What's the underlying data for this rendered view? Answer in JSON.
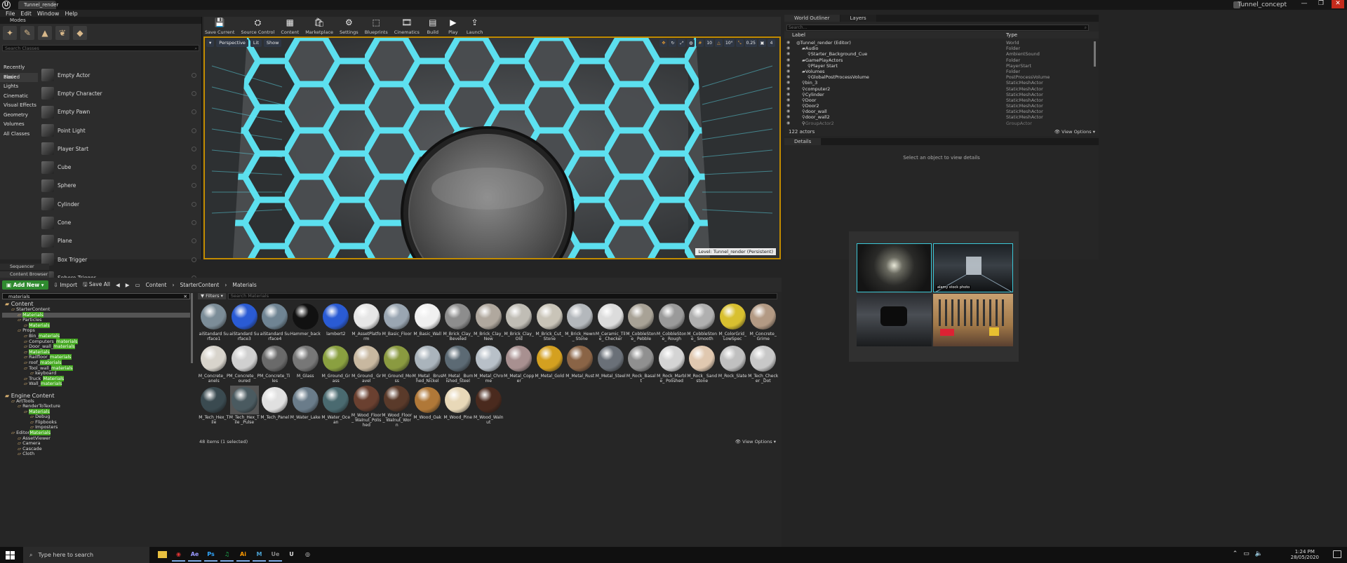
{
  "window": {
    "doc_tab": "Tunnel_render",
    "project_name": "Tunnel_concept",
    "minimize": "—",
    "maximize": "❐",
    "close": "✕"
  },
  "menu": [
    "File",
    "Edit",
    "Window",
    "Help"
  ],
  "modes": {
    "tab_label": "Modes",
    "search_placeholder": "Search Classes",
    "categories": [
      "Recently Placed",
      "Basic",
      "Lights",
      "Cinematic",
      "Visual Effects",
      "Geometry",
      "Volumes",
      "All Classes"
    ],
    "selected_category": "Basic",
    "actors": [
      "Empty Actor",
      "Empty Character",
      "Empty Pawn",
      "Point Light",
      "Player Start",
      "Cube",
      "Sphere",
      "Cylinder",
      "Cone",
      "Plane",
      "Box Trigger",
      "Sphere Trigger"
    ]
  },
  "toolbar": [
    {
      "label": "Save Current",
      "icon": "save-icon"
    },
    {
      "label": "Source Control",
      "icon": "source-control-icon"
    },
    {
      "label": "Content",
      "icon": "content-icon"
    },
    {
      "label": "Marketplace",
      "icon": "marketplace-icon"
    },
    {
      "label": "Settings",
      "icon": "settings-icon"
    },
    {
      "label": "Blueprints",
      "icon": "blueprints-icon"
    },
    {
      "label": "Cinematics",
      "icon": "cinematics-icon"
    },
    {
      "label": "Build",
      "icon": "build-icon"
    },
    {
      "label": "Play",
      "icon": "play-icon"
    },
    {
      "label": "Launch",
      "icon": "launch-icon"
    }
  ],
  "viewport": {
    "perspective": "Perspective",
    "lit": "Lit",
    "show": "Show",
    "snap_grid": "10",
    "snap_rot": "10°",
    "snap_scale": "0.25",
    "cam_speed": "4",
    "level_label": "Level:  Tunnel_render (Persistent)"
  },
  "outliner": {
    "tab": "World Outliner",
    "tab2": "Layers",
    "search_placeholder": "Search...",
    "col_label": "Label",
    "col_type": "Type",
    "rows": [
      {
        "label": "Tunnel_render (Editor)",
        "type": "World",
        "indent": 0
      },
      {
        "label": "Audio",
        "type": "Folder",
        "indent": 1
      },
      {
        "label": "Starter_Background_Cue",
        "type": "AmbientSound",
        "indent": 2
      },
      {
        "label": "GamePlayActors",
        "type": "Folder",
        "indent": 1
      },
      {
        "label": "Player Start",
        "type": "PlayerStart",
        "indent": 2
      },
      {
        "label": "Volumes",
        "type": "Folder",
        "indent": 1
      },
      {
        "label": "GlobalPostProcessVolume",
        "type": "PostProcessVolume",
        "indent": 2
      },
      {
        "label": "bin_3",
        "type": "StaticMeshActor",
        "indent": 1
      },
      {
        "label": "computer2",
        "type": "StaticMeshActor",
        "indent": 1
      },
      {
        "label": "Cylinder",
        "type": "StaticMeshActor",
        "indent": 1
      },
      {
        "label": "Door",
        "type": "StaticMeshActor",
        "indent": 1
      },
      {
        "label": "Door2",
        "type": "StaticMeshActor",
        "indent": 1
      },
      {
        "label": "door_wall",
        "type": "StaticMeshActor",
        "indent": 1
      },
      {
        "label": "door_wall2",
        "type": "StaticMeshActor",
        "indent": 1
      },
      {
        "label": "GroupActor2",
        "type": "GroupActor",
        "indent": 1
      }
    ],
    "count": "122 actors",
    "view_options": "View Options"
  },
  "details": {
    "tab": "Details",
    "empty_message": "Select an object to view details"
  },
  "reference_images": {
    "stock_caption": "alamy stock photo"
  },
  "bottom_tabs": {
    "sequencer": "Sequencer",
    "content_browser": "Content Browser"
  },
  "content_browser": {
    "add_new": "Add New",
    "import": "Import",
    "save_all": "Save All",
    "path": [
      "Content",
      "StarterContent",
      "Materials"
    ],
    "tree_search": "materials",
    "filters_label": "Filters",
    "search_placeholder": "Search Materials",
    "tree": [
      {
        "pre": "",
        "hl": "",
        "post": "Content",
        "indent": 0,
        "header": true
      },
      {
        "pre": "StarterContent",
        "hl": "",
        "post": "",
        "indent": 1
      },
      {
        "pre": "",
        "hl": "Materials",
        "post": "",
        "indent": 2,
        "selected": true
      },
      {
        "pre": "Particles",
        "hl": "",
        "post": "",
        "indent": 2
      },
      {
        "pre": "",
        "hl": "Materials",
        "post": "",
        "indent": 3
      },
      {
        "pre": "Props",
        "hl": "",
        "post": "",
        "indent": 2
      },
      {
        "pre": "Bin_",
        "hl": "materials",
        "post": "",
        "indent": 3
      },
      {
        "pre": "Computers_",
        "hl": "materials",
        "post": "",
        "indent": 3
      },
      {
        "pre": "Door_wall_",
        "hl": "materials",
        "post": "",
        "indent": 3
      },
      {
        "pre": "",
        "hl": "Materials",
        "post": "",
        "indent": 3
      },
      {
        "pre": "Railfloor_",
        "hl": "materials",
        "post": "",
        "indent": 3
      },
      {
        "pre": "roof_",
        "hl": "materials",
        "post": "",
        "indent": 3
      },
      {
        "pre": "Tool_wall_",
        "hl": "materials",
        "post": "",
        "indent": 3
      },
      {
        "pre": "keyboard",
        "hl": "",
        "post": "",
        "indent": 4
      },
      {
        "pre": "Truck_",
        "hl": "Materials",
        "post": "",
        "indent": 3
      },
      {
        "pre": "Wall_",
        "hl": "materials",
        "post": "",
        "indent": 3
      },
      {
        "pre": "",
        "hl": "",
        "post": "",
        "indent": 0,
        "spacer": true
      },
      {
        "pre": "Engine Content",
        "hl": "",
        "post": "",
        "indent": 0,
        "header": true
      },
      {
        "pre": "ArtTools",
        "hl": "",
        "post": "",
        "indent": 1
      },
      {
        "pre": "RenderToTexture",
        "hl": "",
        "post": "",
        "indent": 2
      },
      {
        "pre": "",
        "hl": "Materials",
        "post": "",
        "indent": 3
      },
      {
        "pre": "Debug",
        "hl": "",
        "post": "",
        "indent": 4
      },
      {
        "pre": "Flipbooks",
        "hl": "",
        "post": "",
        "indent": 4
      },
      {
        "pre": "Imposters",
        "hl": "",
        "post": "",
        "indent": 4
      },
      {
        "pre": "Editor",
        "hl": "Materials",
        "post": "",
        "indent": 1
      },
      {
        "pre": "AssetViewer",
        "hl": "",
        "post": "",
        "indent": 2
      },
      {
        "pre": "Camera",
        "hl": "",
        "post": "",
        "indent": 2
      },
      {
        "pre": "Cascade",
        "hl": "",
        "post": "",
        "indent": 2
      },
      {
        "pre": "Cloth",
        "hl": "",
        "post": "",
        "indent": 2
      }
    ],
    "assets": [
      [
        {
          "name": "aiStandard Surface1",
          "color": "#7c8d98"
        },
        {
          "name": "aiStandard Surface3",
          "color": "#2a5bd4"
        },
        {
          "name": "aiStandard Surface4",
          "color": "#6f8493"
        },
        {
          "name": "Hammer_back",
          "color": "#111111"
        },
        {
          "name": "lambert2",
          "color": "#2a5bd4"
        },
        {
          "name": "M_AssetPlatform",
          "color": "#e6e6e6"
        },
        {
          "name": "M_Basic_Floor",
          "color": "#9aa6b2"
        },
        {
          "name": "M_Basic_Wall",
          "color": "#f0f0f0"
        },
        {
          "name": "M_Brick_Clay_ Beveled",
          "color": "#8d8d8d"
        },
        {
          "name": "M_Brick_Clay_ New",
          "color": "#b0a89e"
        },
        {
          "name": "M_Brick_Clay_ Old",
          "color": "#c0bdb5"
        },
        {
          "name": "M_Brick_Cut_ Stone",
          "color": "#c9c4b8"
        },
        {
          "name": "M_Brick_Hewn_ Stone",
          "color": "#b4b8bc"
        },
        {
          "name": "M_Ceramic_Tile_ Checker",
          "color": "#dcdcdc"
        },
        {
          "name": "M_CobbleStone_ Pebble",
          "color": "#a8a296"
        },
        {
          "name": "M_CobbleStone_ Rough",
          "color": "#9a9a9a"
        },
        {
          "name": "M_CobbleStone_ Smooth",
          "color": "#b0b0b0"
        },
        {
          "name": "M_ColorGrid_ LowSpec",
          "color": "#d8c030"
        },
        {
          "name": "M_Concrete_ Grime",
          "color": "#b39a84"
        }
      ],
      [
        {
          "name": "M_Concrete_ Panels",
          "color": "#d8d4cc"
        },
        {
          "name": "M_Concrete_ Poured",
          "color": "#d0d0d0"
        },
        {
          "name": "M_Concrete_Tiles",
          "color": "#6a6a6a"
        },
        {
          "name": "M_Glass",
          "color": "#777777"
        },
        {
          "name": "M_Ground_Grass",
          "color": "#8aa040"
        },
        {
          "name": "M_Ground_ Gravel",
          "color": "#c8b8a0"
        },
        {
          "name": "M_Ground_Moss",
          "color": "#8a9a40"
        },
        {
          "name": "M_Metal_ Brushed_Nickel",
          "color": "#aab4bc"
        },
        {
          "name": "M_Metal_ Burnished_Steel",
          "color": "#5c6a74"
        },
        {
          "name": "M_Metal_Chrome",
          "color": "#b8c0c8"
        },
        {
          "name": "M_Metal_Copper",
          "color": "#a89090"
        },
        {
          "name": "M_Metal_Gold",
          "color": "#d4a020"
        },
        {
          "name": "M_Metal_Rust",
          "color": "#8a6446"
        },
        {
          "name": "M_Metal_Steel",
          "color": "#6a7078"
        },
        {
          "name": "M_Rock_Basalt",
          "color": "#909090"
        },
        {
          "name": "M_Rock_Marble_ Polished",
          "color": "#d4d4d4"
        },
        {
          "name": "M_Rock_ Sandstone",
          "color": "#e0c8b0"
        },
        {
          "name": "M_Rock_Slate",
          "color": "#c0c0c0"
        },
        {
          "name": "M_Tech_Checker _Dot",
          "color": "#c8c8c8"
        }
      ],
      [
        {
          "name": "M_Tech_Hex_Tile",
          "color": "#3a4a50"
        },
        {
          "name": "M_Tech_Hex_Tile _Pulse",
          "color": "#4a5a60",
          "selected": true
        },
        {
          "name": "M_Tech_Panel",
          "color": "#e0e0e0"
        },
        {
          "name": "M_Water_Lake",
          "color": "#6a7c8a"
        },
        {
          "name": "M_Water_Ocean",
          "color": "#4a6a70"
        },
        {
          "name": "M_Wood_Floor_ Walnut_Polished",
          "color": "#6a4030"
        },
        {
          "name": "M_Wood_Floor_ Walnut_Worn",
          "color": "#5a3a2a"
        },
        {
          "name": "M_Wood_Oak",
          "color": "#b07838"
        },
        {
          "name": "M_Wood_Pine",
          "color": "#e8d8b8"
        },
        {
          "name": "M_Wood_Walnut",
          "color": "#4a2a1e"
        }
      ]
    ],
    "status": "48 items (1 selected)",
    "view_options": "View Options"
  },
  "taskbar": {
    "search_placeholder": "Type here to search",
    "apps": [
      "",
      "◉",
      "Ae",
      "Ps",
      "♫",
      "Ai",
      "M",
      "Ue",
      "U",
      "◎"
    ],
    "app_colors": [
      "#e8c040",
      "#d33",
      "#9999ff",
      "#31a8ff",
      "#1db954",
      "#ff9a00",
      "#4aa0d0",
      "#888",
      "#ddd",
      "#ddd"
    ],
    "time": "1:24 PM",
    "date": "28/05/2020"
  }
}
